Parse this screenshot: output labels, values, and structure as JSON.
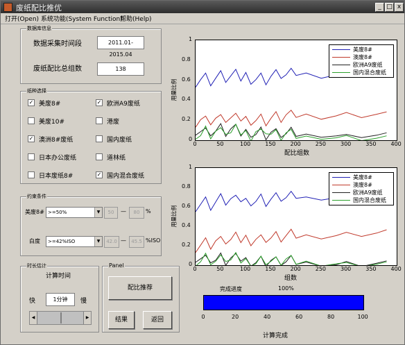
{
  "window": {
    "title": "废纸配比推优"
  },
  "menu": [
    "打开(Open)",
    "系统功能(System Function)",
    "帮助(Help)"
  ],
  "data_info": {
    "title": "数据库信息",
    "period_label": "数据采集时间段",
    "period_value": "2011.01-2015.04",
    "groups_label": "废纸配比总组数",
    "groups_value": "138"
  },
  "paper_select": {
    "title": "纸种选择",
    "items": [
      {
        "label": "美废8#",
        "checked": true
      },
      {
        "label": "欧洲A9废纸",
        "checked": true
      },
      {
        "label": "美废10#",
        "checked": false
      },
      {
        "label": "港废",
        "checked": false
      },
      {
        "label": "澳洲8#废纸",
        "checked": true
      },
      {
        "label": "国内废纸",
        "checked": false
      },
      {
        "label": "日本办公废纸",
        "checked": false
      },
      {
        "label": "道林纸",
        "checked": false
      },
      {
        "label": "日本废纸8#",
        "checked": false
      },
      {
        "label": "国内混合废纸",
        "checked": true
      }
    ]
  },
  "constraints": {
    "title": "约束条件",
    "row1": {
      "label": "美废8#",
      "select": ">=50%",
      "low": "50",
      "dash": "—",
      "high": "80",
      "unit": "%"
    },
    "row2": {
      "label": "白度",
      "select": ">=42%ISO",
      "low": "42.0",
      "dash": "—",
      "high": "45.5",
      "unit": "%ISO"
    }
  },
  "time_est": {
    "title": "时长估计",
    "label": "计算时间",
    "fast": "快",
    "slow": "慢",
    "value": "1分钟"
  },
  "panel": {
    "title": "Panel",
    "recommend": "配比推荐",
    "result": "结果",
    "back": "返回"
  },
  "progress": {
    "label": "完成进度",
    "percent_text": "100%",
    "fraction": 1.0,
    "ticks": [
      "0",
      "20",
      "40",
      "60",
      "80",
      "100"
    ],
    "status": "计算完成",
    "color": "#0000ff"
  },
  "chart_data": [
    {
      "type": "line",
      "xlabel": "配比组数",
      "ylabel": "用量比例",
      "xlim": [
        0,
        400
      ],
      "ylim": [
        0,
        1
      ],
      "xticks": [
        "0",
        "50",
        "100",
        "150",
        "200",
        "250",
        "300",
        "350",
        "400"
      ],
      "yticks": [
        "0",
        "0.2",
        "0.4",
        "0.6",
        "0.8",
        "1"
      ],
      "legend_position": "top-right",
      "series": [
        {
          "name": "美废8#",
          "color": "#1f1fb4",
          "x": [
            0,
            10,
            20,
            30,
            40,
            50,
            60,
            70,
            80,
            90,
            100,
            110,
            120,
            130,
            140,
            150,
            160,
            170,
            180,
            190,
            200,
            220,
            250,
            280,
            300,
            330,
            360,
            380
          ],
          "y": [
            0.6,
            0.62,
            0.63,
            0.6,
            0.62,
            0.64,
            0.62,
            0.63,
            0.64,
            0.62,
            0.65,
            0.63,
            0.62,
            0.63,
            0.61,
            0.64,
            0.65,
            0.66,
            0.64,
            0.65,
            0.66,
            0.66,
            0.65,
            0.66,
            0.66,
            0.67,
            0.66,
            0.67
          ]
        },
        {
          "name": "澳废8#",
          "color": "#c0392b",
          "x": [
            0,
            10,
            20,
            30,
            40,
            50,
            60,
            70,
            80,
            90,
            100,
            110,
            120,
            130,
            140,
            150,
            160,
            170,
            180,
            190,
            200,
            220,
            250,
            280,
            300,
            330,
            360,
            380
          ],
          "y": [
            0.2,
            0.22,
            0.2,
            0.21,
            0.22,
            0.2,
            0.22,
            0.21,
            0.2,
            0.22,
            0.21,
            0.22,
            0.21,
            0.22,
            0.2,
            0.22,
            0.23,
            0.22,
            0.24,
            0.23,
            0.24,
            0.25,
            0.24,
            0.25,
            0.26,
            0.25,
            0.26,
            0.26
          ]
        },
        {
          "name": "欧洲A9废纸",
          "color": "#202020",
          "x": [
            0,
            10,
            20,
            30,
            40,
            50,
            60,
            70,
            80,
            90,
            100,
            110,
            120,
            130,
            140,
            150,
            160,
            170,
            180,
            190,
            200,
            220,
            250,
            280,
            300,
            330,
            360,
            380
          ],
          "y": [
            0.12,
            0.1,
            0.08,
            0.1,
            0.09,
            0.11,
            0.08,
            0.1,
            0.09,
            0.07,
            0.08,
            0.1,
            0.07,
            0.09,
            0.06,
            0.08,
            0.06,
            0.07,
            0.05,
            0.06,
            0.05,
            0.05,
            0.06,
            0.05,
            0.04,
            0.05,
            0.05,
            0.05
          ]
        },
        {
          "name": "国内混合废纸",
          "color": "#2ca02c",
          "x": [
            0,
            10,
            20,
            30,
            40,
            50,
            60,
            70,
            80,
            90,
            100,
            110,
            120,
            130,
            140,
            150,
            160,
            170,
            180,
            190,
            200,
            220,
            250,
            280,
            300,
            330,
            360,
            380
          ],
          "y": [
            0.08,
            0.06,
            0.1,
            0.07,
            0.09,
            0.07,
            0.1,
            0.06,
            0.09,
            0.08,
            0.07,
            0.06,
            0.1,
            0.07,
            0.12,
            0.06,
            0.05,
            0.04,
            0.06,
            0.04,
            0.03,
            0.03,
            0.04,
            0.03,
            0.03,
            0.02,
            0.02,
            0.02
          ]
        }
      ]
    },
    {
      "type": "line",
      "xlabel": "组数",
      "ylabel": "用量比例",
      "xlim": [
        0,
        400
      ],
      "ylim": [
        0,
        1
      ],
      "xticks": [
        "0",
        "50",
        "100",
        "150",
        "200",
        "250",
        "300",
        "350",
        "400"
      ],
      "yticks": [
        "0",
        "0.2",
        "0.4",
        "0.6",
        "0.8",
        "1"
      ],
      "legend_position": "top-right",
      "series": [
        {
          "name": "美废8#",
          "color": "#1f1fb4",
          "x": [
            0,
            10,
            20,
            30,
            40,
            50,
            60,
            70,
            80,
            90,
            100,
            110,
            120,
            130,
            140,
            150,
            160,
            170,
            180,
            190,
            200,
            220,
            250,
            280,
            300,
            330,
            360,
            380
          ],
          "y": [
            0.62,
            0.64,
            0.66,
            0.62,
            0.65,
            0.68,
            0.66,
            0.67,
            0.65,
            0.68,
            0.66,
            0.68,
            0.67,
            0.69,
            0.66,
            0.68,
            0.69,
            0.7,
            0.68,
            0.69,
            0.7,
            0.69,
            0.7,
            0.7,
            0.69,
            0.7,
            0.7,
            0.7
          ]
        },
        {
          "name": "澳废8#",
          "color": "#c0392b",
          "x": [
            0,
            10,
            20,
            30,
            40,
            50,
            60,
            70,
            80,
            90,
            100,
            110,
            120,
            130,
            140,
            150,
            160,
            170,
            180,
            190,
            200,
            220,
            250,
            280,
            300,
            330,
            360,
            380
          ],
          "y": [
            0.2,
            0.22,
            0.24,
            0.22,
            0.25,
            0.24,
            0.26,
            0.25,
            0.27,
            0.26,
            0.28,
            0.27,
            0.28,
            0.27,
            0.29,
            0.28,
            0.29,
            0.28,
            0.29,
            0.3,
            0.29,
            0.3,
            0.3,
            0.31,
            0.32,
            0.32,
            0.33,
            0.34
          ]
        },
        {
          "name": "欧洲A9废纸",
          "color": "#202020",
          "x": [
            0,
            10,
            20,
            30,
            40,
            50,
            60,
            70,
            80,
            90,
            100,
            110,
            120,
            130,
            140,
            150,
            160,
            170,
            180,
            190,
            200,
            220,
            250,
            280,
            300,
            330,
            360,
            380
          ],
          "y": [
            0.1,
            0.08,
            0.06,
            0.08,
            0.05,
            0.07,
            0.04,
            0.06,
            0.05,
            0.07,
            0.05,
            0.06,
            0.04,
            0.05,
            0.04,
            0.05,
            0.03,
            0.04,
            0.02,
            0.03,
            0.02,
            0.02,
            0.02,
            0.01,
            0.02,
            0.01,
            0.02,
            0.02
          ]
        },
        {
          "name": "国内混合废纸",
          "color": "#2ca02c",
          "x": [
            0,
            10,
            20,
            30,
            40,
            50,
            60,
            70,
            80,
            90,
            100,
            110,
            120,
            130,
            140,
            150,
            160,
            170,
            180,
            190,
            200,
            220,
            250,
            280,
            300,
            330,
            360,
            380
          ],
          "y": [
            0.06,
            0.05,
            0.08,
            0.06,
            0.04,
            0.05,
            0.08,
            0.04,
            0.06,
            0.05,
            0.04,
            0.06,
            0.03,
            0.05,
            0.06,
            0.04,
            0.03,
            0.04,
            0.05,
            0.03,
            0.02,
            0.03,
            0.02,
            0.02,
            0.01,
            0.01,
            0.01,
            0.01
          ]
        }
      ]
    }
  ]
}
